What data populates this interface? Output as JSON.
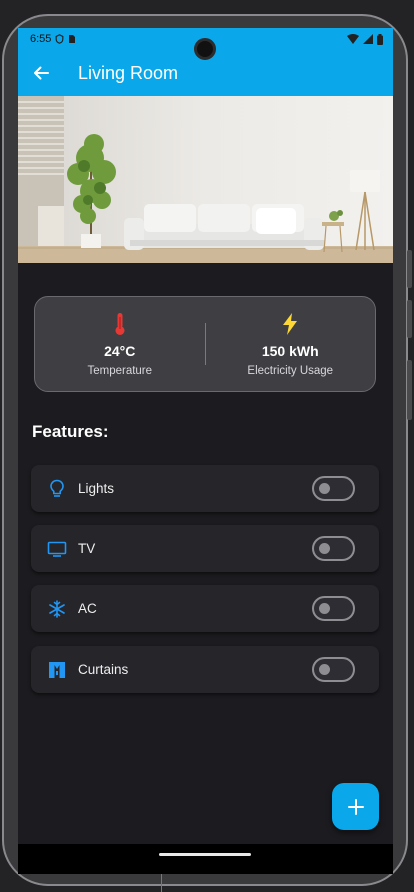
{
  "status_bar": {
    "time": "6:55"
  },
  "app_bar": {
    "title": "Living Room"
  },
  "stats": {
    "temperature": {
      "value": "24°C",
      "label": "Temperature"
    },
    "electricity": {
      "value": "150 kWh",
      "label": "Electricity Usage"
    }
  },
  "features": {
    "title": "Features:",
    "items": [
      {
        "label": "Lights",
        "icon": "lightbulb-icon",
        "on": false
      },
      {
        "label": "TV",
        "icon": "tv-icon",
        "on": false
      },
      {
        "label": "AC",
        "icon": "snowflake-icon",
        "on": false
      },
      {
        "label": "Curtains",
        "icon": "curtains-icon",
        "on": false
      }
    ]
  },
  "colors": {
    "accent": "#0aa8ea",
    "temperature": "#e53935",
    "electricity": "#fdd835",
    "feature_icon": "#2196f3",
    "background": "#1c1b1f"
  }
}
